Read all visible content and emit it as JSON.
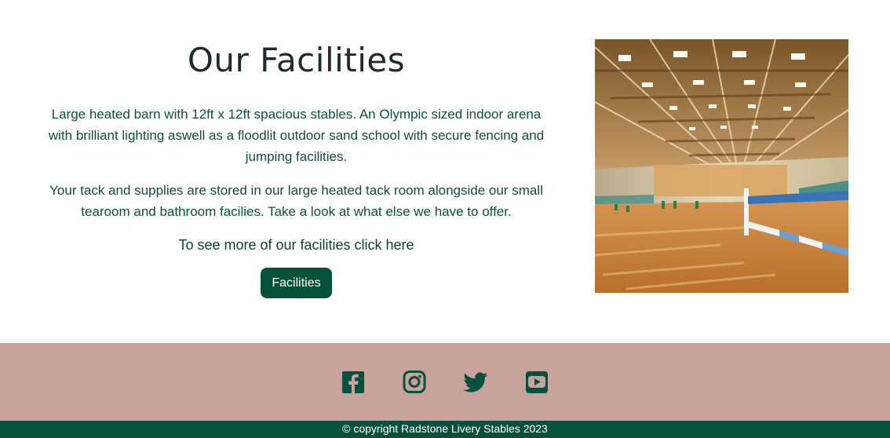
{
  "facilities": {
    "title": "Our Facilities",
    "paragraph_1": "Large heated barn with 12ft x 12ft spacious stables. An Olympic sized indoor arena with brilliant lighting aswell as a floodlit outdoor sand school with secure fencing and jumping facilities.",
    "paragraph_2": "Your tack and supplies are stored in our large heated tack room alongside our small tearoom and bathroom facilies. Take a look at what else we have to offer.",
    "cta_text": "To see more of our facilities click here",
    "button_label": "Facilities",
    "image_alt": "indoor arena photo"
  },
  "footer": {
    "social_icons": [
      "facebook-icon",
      "instagram-icon",
      "twitter-icon",
      "youtube-icon"
    ],
    "copyright": "© copyright Radstone Livery Stables 2023"
  },
  "colors": {
    "brand_green": "#06513e",
    "footer_pink": "#c8a39c",
    "title_text": "#1d2a30",
    "body_text": "#0f4d3f"
  }
}
